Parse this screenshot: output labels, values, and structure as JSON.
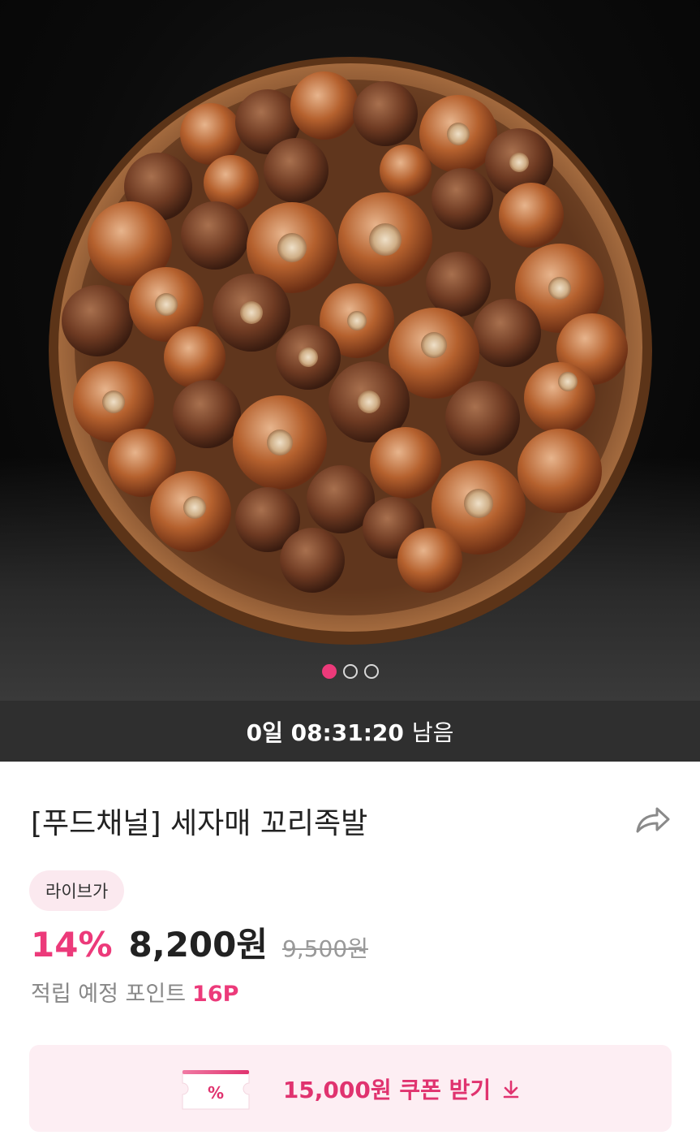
{
  "carousel": {
    "image_alt": "꼬리족발",
    "slides": 3,
    "active_index": 0,
    "active_color": "#ec3a7a"
  },
  "timer": {
    "countdown": "0일 08:31:20",
    "suffix": "남음"
  },
  "product": {
    "title": "[푸드채널] 세자매 꼬리족발",
    "badge": "라이브가",
    "discount": "14%",
    "price": "8,200원",
    "original_price": "9,500원",
    "points_label": "적립 예정 포인트",
    "points_value": "16P",
    "share_icon": "share-icon"
  },
  "coupon": {
    "icon_text": "%",
    "label": "15,000원 쿠폰 받기",
    "icon": "download-icon",
    "accent": "#e0336f"
  }
}
